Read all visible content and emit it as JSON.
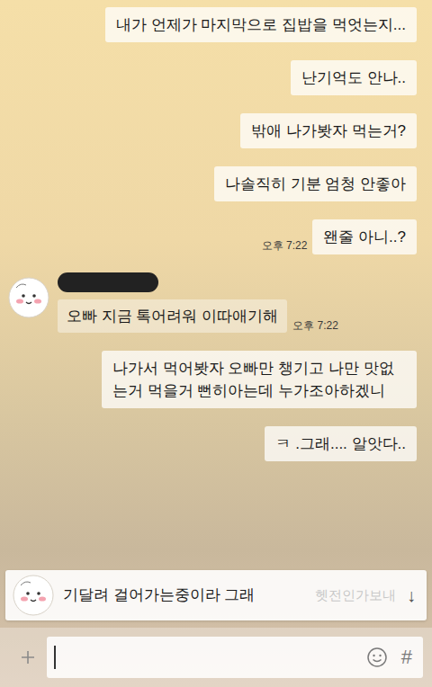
{
  "chat": {
    "messages": [
      {
        "kind": "outgoing",
        "text": "내가 언제가 마지막으로 집밥을 먹엇는지..."
      },
      {
        "kind": "outgoing",
        "text": "난기억도 안나.."
      },
      {
        "kind": "outgoing",
        "text": "밖애 나가봣자 먹는거?"
      },
      {
        "kind": "outgoing",
        "text": "나솔직히 기분 엄청 안좋아"
      },
      {
        "kind": "outgoing",
        "text": "왠줄 아니..?",
        "time": "오후 7:22"
      },
      {
        "kind": "incoming",
        "sender": {
          "redacted": true
        },
        "text": "오빠 지금 톡어려워 이따애기해",
        "time": "오후 7:22"
      },
      {
        "kind": "outgoing",
        "text": "나가서 먹어봣자 오빠만 챙기고 나만 맛없는거 먹을거 뻔히아는데 누가조아하겠니"
      },
      {
        "kind": "outgoing",
        "text": "ㅋ .그래.... 알앗다.."
      }
    ]
  },
  "notification": {
    "text": "기달려 걸어가는중이라 그래",
    "trailing_text": "헷전인가보내",
    "arrow": "↓"
  },
  "composer": {
    "hash": "#"
  }
}
